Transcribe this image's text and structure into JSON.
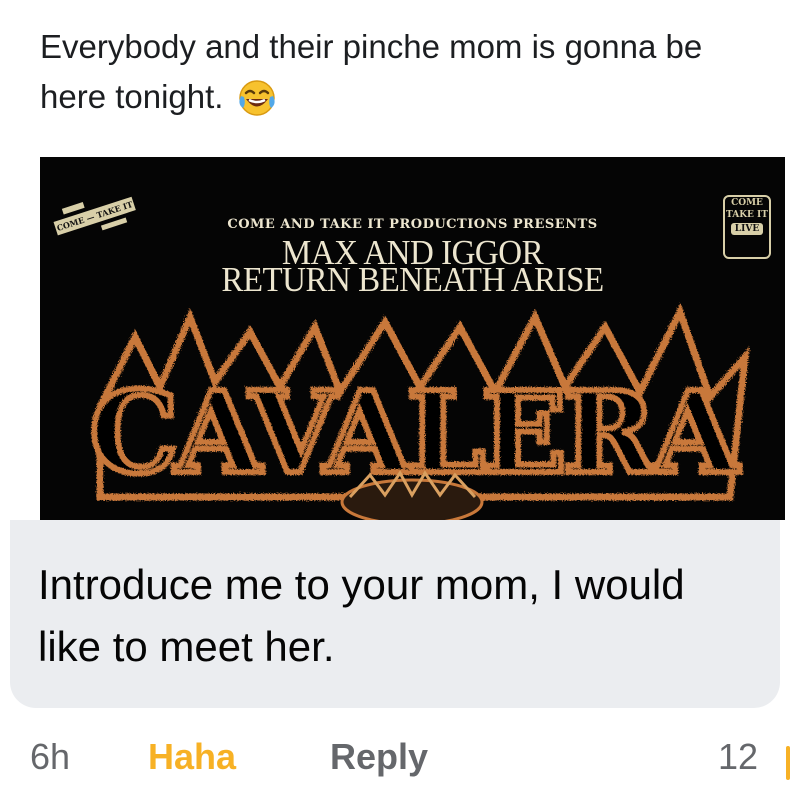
{
  "post": {
    "text": "Everybody and their pinche mom is gonna be here tonight.",
    "emoji": "laughing-with-tears-emoji"
  },
  "flyer": {
    "badge_left": "COME — TAKE IT",
    "presents": "COME AND TAKE IT PRODUCTIONS PRESENTS",
    "headliner_line1": "MAX AND IGGOR",
    "headliner_line2": "RETURN BENEATH ARISE",
    "badge_right_top": "COME",
    "badge_right_mid": "TAKE IT",
    "badge_right_live": "LIVE",
    "logo_text": "CAVALERA",
    "logo_color": "#c8783a"
  },
  "comment": {
    "text": "Introduce me to your mom, I would like to meet her."
  },
  "actions": {
    "time": "6h",
    "haha": "Haha",
    "reply": "Reply",
    "count": "12",
    "haha_color": "#f7b125"
  }
}
